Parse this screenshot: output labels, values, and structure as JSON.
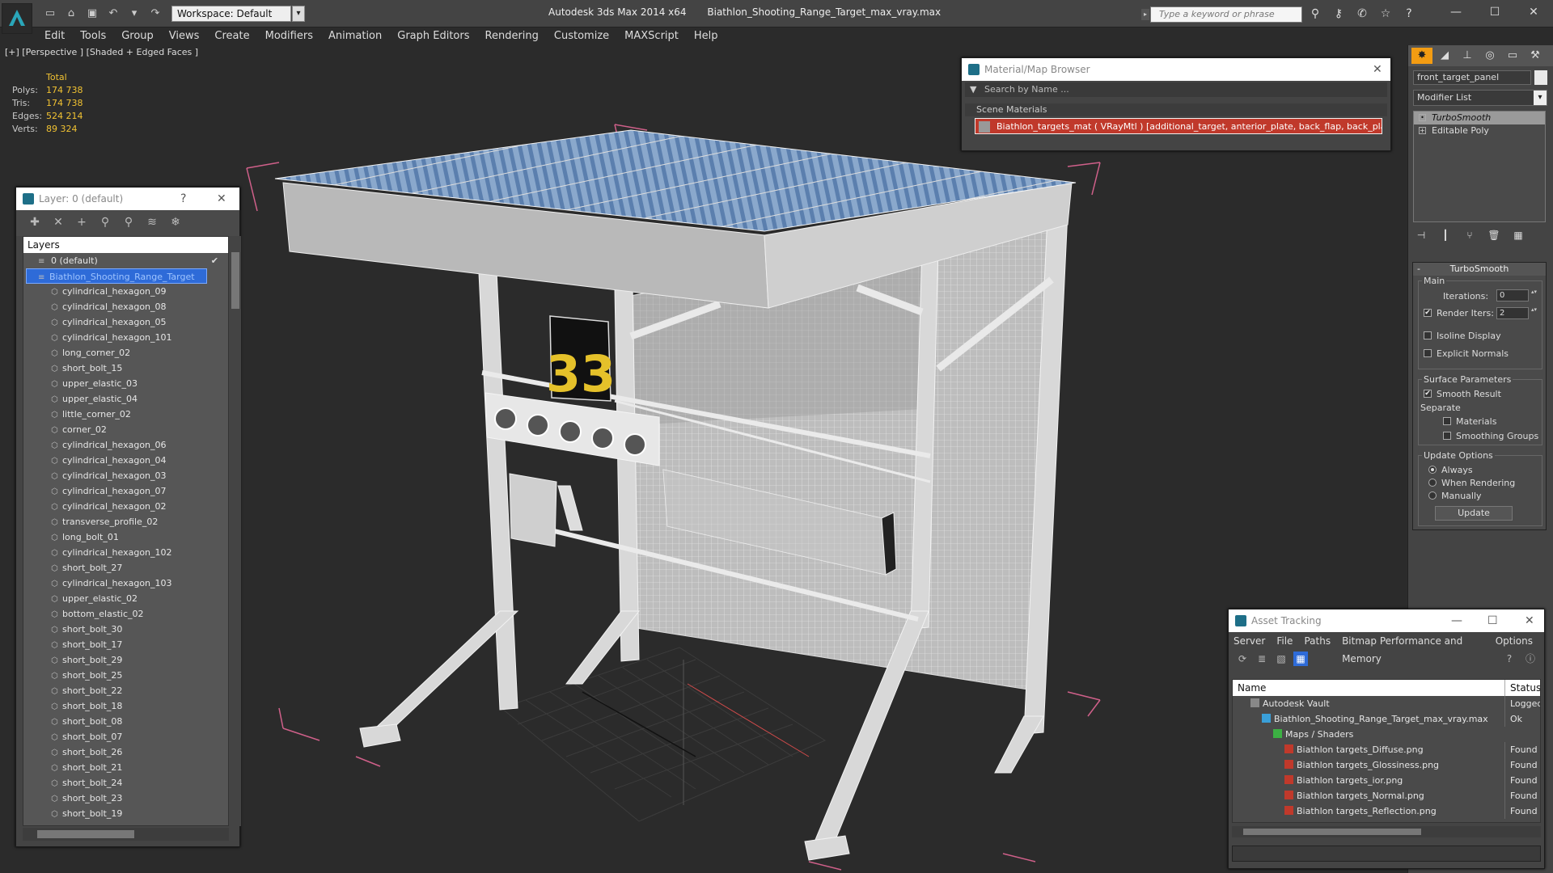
{
  "titlebar": {
    "workspace": "Workspace: Default",
    "app": "Autodesk 3ds Max  2014 x64",
    "file": "Biathlon_Shooting_Range_Target_max_vray.max",
    "search_placeholder": "Type a keyword or phrase"
  },
  "menu": [
    "Edit",
    "Tools",
    "Group",
    "Views",
    "Create",
    "Modifiers",
    "Animation",
    "Graph Editors",
    "Rendering",
    "Customize",
    "MAXScript",
    "Help"
  ],
  "viewport": {
    "label": "[+] [Perspective ] [Shaded + Edged Faces ]",
    "target_number": "33"
  },
  "stats": {
    "header": "Total",
    "rows": [
      {
        "k": "Polys:",
        "v": "174 738"
      },
      {
        "k": "Tris:",
        "v": "174 738"
      },
      {
        "k": "Edges:",
        "v": "524 214"
      },
      {
        "k": "Verts:",
        "v": "89 324"
      }
    ]
  },
  "layer_panel": {
    "title": "Layer: 0 (default)",
    "help": "?",
    "list_header": "Layers",
    "default_layer": "0 (default)",
    "selected_layer": "Biathlon_Shooting_Range_Target",
    "items": [
      "cylindrical_hexagon_09",
      "cylindrical_hexagon_08",
      "cylindrical_hexagon_05",
      "cylindrical_hexagon_101",
      "long_corner_02",
      "short_bolt_15",
      "upper_elastic_03",
      "upper_elastic_04",
      "little_corner_02",
      "corner_02",
      "cylindrical_hexagon_06",
      "cylindrical_hexagon_04",
      "cylindrical_hexagon_03",
      "cylindrical_hexagon_07",
      "cylindrical_hexagon_02",
      "transverse_profile_02",
      "long_bolt_01",
      "cylindrical_hexagon_102",
      "short_bolt_27",
      "cylindrical_hexagon_103",
      "upper_elastic_02",
      "bottom_elastic_02",
      "short_bolt_30",
      "short_bolt_17",
      "short_bolt_29",
      "short_bolt_25",
      "short_bolt_22",
      "short_bolt_18",
      "short_bolt_08",
      "short_bolt_07",
      "short_bolt_26",
      "short_bolt_21",
      "short_bolt_24",
      "short_bolt_23",
      "short_bolt_19"
    ]
  },
  "material_browser": {
    "title": "Material/Map Browser",
    "search": "Search by Name ...",
    "section": "Scene Materials",
    "material": "Biathlon_targets_mat ( VRayMtl ) [additional_target, anterior_plate, back_flap, back_plate..."
  },
  "command_panel": {
    "object_name": "front_target_panel",
    "modifier_list": "Modifier List",
    "stack": [
      "TurboSmooth",
      "Editable Poly"
    ],
    "rollout": "TurboSmooth",
    "main_group": "Main",
    "iterations_label": "Iterations:",
    "iterations": "0",
    "render_iters_label": "Render Iters:",
    "render_iters": "2",
    "isoline": "Isoline Display",
    "explicit_normals": "Explicit Normals",
    "surface_group": "Surface Parameters",
    "smooth_result": "Smooth Result",
    "separate": "Separate",
    "materials": "Materials",
    "smoothing_groups": "Smoothing Groups",
    "update_group": "Update Options",
    "always": "Always",
    "when_rendering": "When Rendering",
    "manually": "Manually",
    "update_button": "Update"
  },
  "asset_tracking": {
    "title": "Asset Tracking",
    "menus": [
      "Server",
      "File",
      "Paths",
      "Bitmap Performance and Memory",
      "Options"
    ],
    "col_name": "Name",
    "col_status": "Status",
    "rows": [
      {
        "name": "Autodesk Vault",
        "status": "Logged O"
      },
      {
        "name": "Biathlon_Shooting_Range_Target_max_vray.max",
        "status": "Ok"
      },
      {
        "name": "Maps / Shaders",
        "status": ""
      },
      {
        "name": "Biathlon targets_Diffuse.png",
        "status": "Found"
      },
      {
        "name": "Biathlon targets_Glossiness.png",
        "status": "Found"
      },
      {
        "name": "Biathlon targets_ior.png",
        "status": "Found"
      },
      {
        "name": "Biathlon targets_Normal.png",
        "status": "Found"
      },
      {
        "name": "Biathlon targets_Reflection.png",
        "status": "Found"
      }
    ]
  },
  "colors": {
    "accent": "#f39c12",
    "selection": "#2e6bd8",
    "stat_value": "#f1c232",
    "material_highlight": "#c0392b"
  }
}
